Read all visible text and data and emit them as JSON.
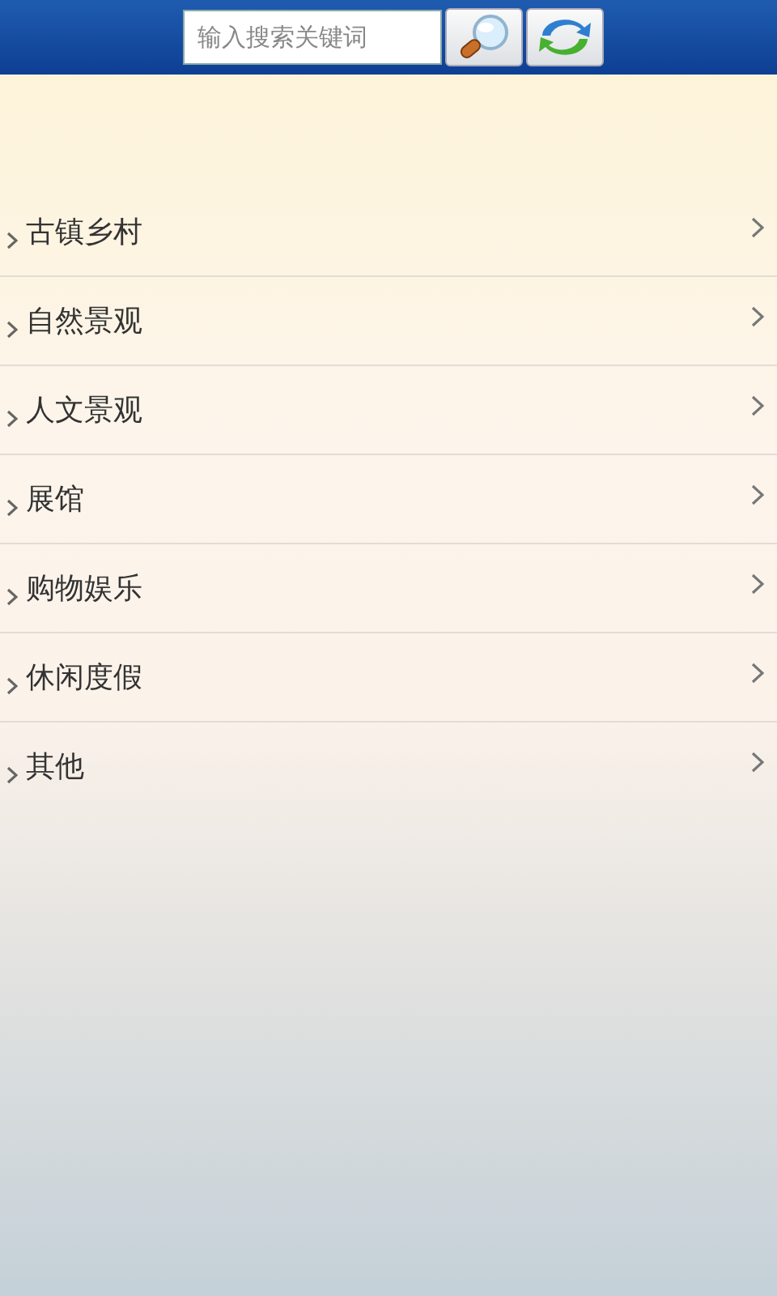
{
  "search": {
    "placeholder": "输入搜索关键词"
  },
  "categories": [
    {
      "label": "古镇乡村"
    },
    {
      "label": "自然景观"
    },
    {
      "label": "人文景观"
    },
    {
      "label": "展馆"
    },
    {
      "label": "购物娱乐"
    },
    {
      "label": "休闲度假"
    },
    {
      "label": "其他"
    }
  ]
}
